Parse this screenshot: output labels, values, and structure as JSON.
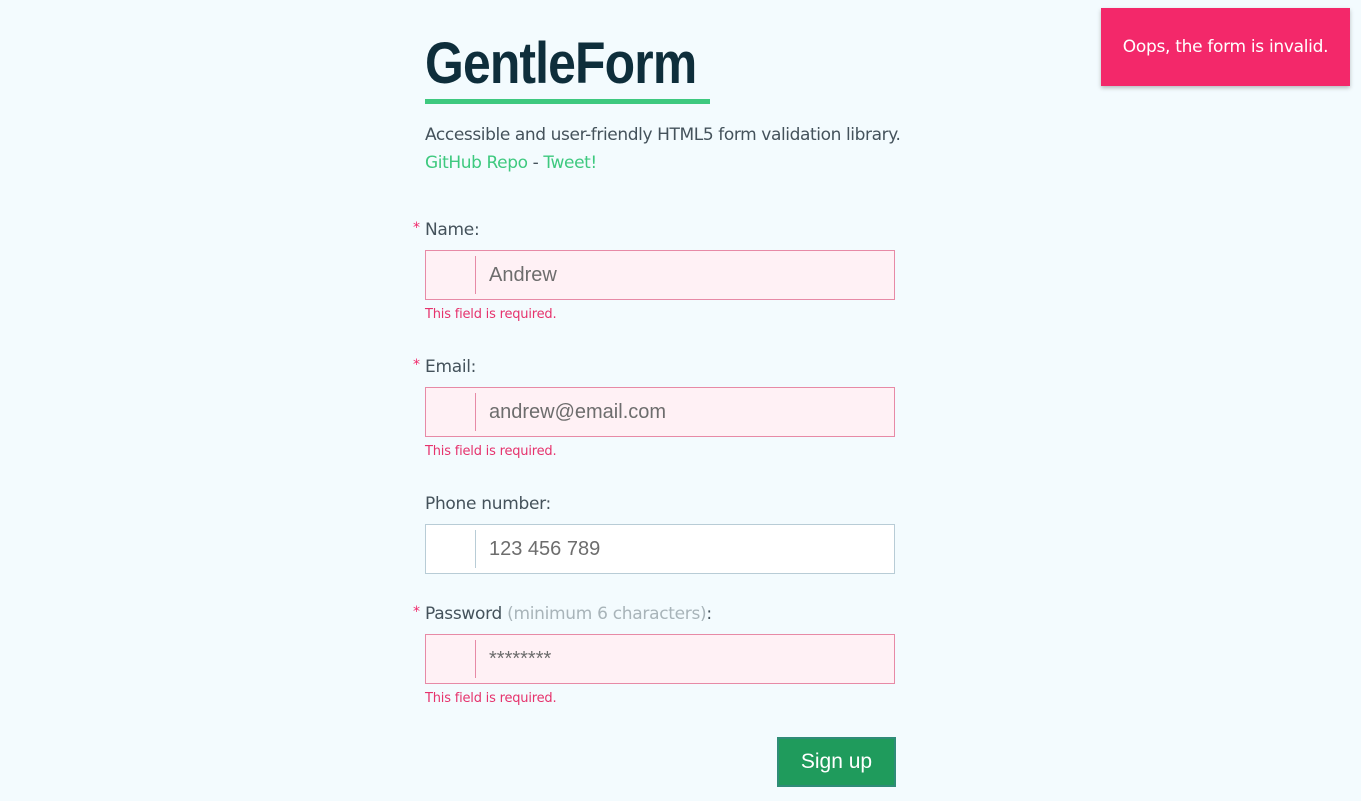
{
  "header": {
    "title": "GentleForm",
    "subtitle": "Accessible and user-friendly HTML5 form validation library.",
    "github_link": "GitHub Repo",
    "separator": " - ",
    "tweet_link": "Tweet!"
  },
  "form": {
    "name": {
      "required_mark": "*",
      "label": "Name:",
      "value": "Andrew",
      "error": "This field is required."
    },
    "email": {
      "required_mark": "*",
      "label": "Email:",
      "value": "andrew@email.com",
      "error": "This field is required."
    },
    "phone": {
      "label": "Phone number:",
      "value": "123 456 789"
    },
    "password": {
      "required_mark": "*",
      "label": "Password",
      "hint": "(minimum 6 characters)",
      "label_suffix": ":",
      "value": "********",
      "error": "This field is required."
    },
    "submit_label": "Sign up"
  },
  "toast": {
    "message": "Oops, the form is invalid."
  },
  "colors": {
    "background": "#f3fbfe",
    "accent": "#3ec97f",
    "error": "#f0286a",
    "button": "#1f9b5c"
  }
}
